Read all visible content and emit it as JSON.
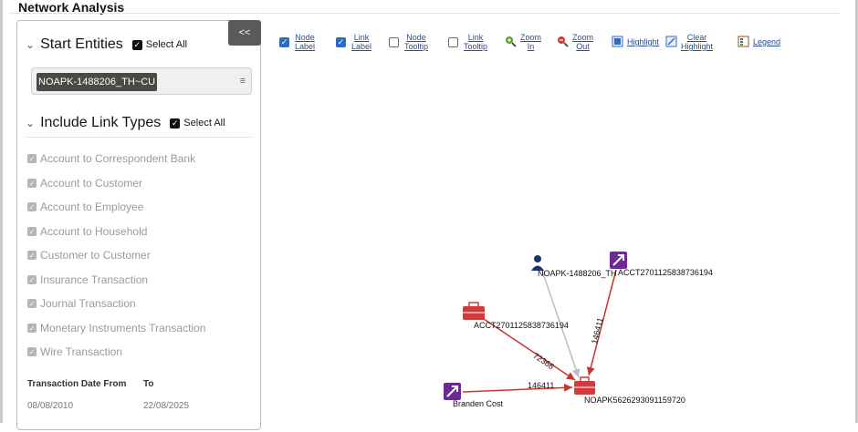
{
  "page": {
    "title": "Network Analysis"
  },
  "panel": {
    "collapse_label": "<<",
    "start_entities": {
      "title": "Start Entities",
      "select_all": "Select All",
      "entity_chip": "NOAPK-1488206_TH~CU"
    },
    "link_types": {
      "title": "Include Link Types",
      "select_all": "Select All",
      "items": [
        "Account to Correspondent Bank",
        "Account to Customer",
        "Account to Employee",
        "Account to Household",
        "Customer to Customer",
        "Insurance Transaction",
        "Journal Transaction",
        "Monetary Instruments Transaction",
        "Wire Transaction"
      ]
    },
    "dates": {
      "from_label": "Transaction Date From",
      "to_label": "To",
      "from_value": "08/08/2010",
      "to_value": "22/08/2025"
    }
  },
  "toolbar": {
    "node_label": [
      "Node",
      "Label"
    ],
    "link_label": [
      "Link",
      "Label"
    ],
    "node_tooltip": [
      "Node",
      "Tooltip"
    ],
    "link_tooltip": [
      "Link",
      "Tooltip"
    ],
    "zoom_in": [
      "Zoom",
      "In"
    ],
    "zoom_out": [
      "Zoom",
      "Out"
    ],
    "highlight": "Highlight",
    "clear_highlight": [
      "Clear",
      "Highlight"
    ],
    "legend": "Legend",
    "node_label_checked": true,
    "link_label_checked": true,
    "node_tooltip_checked": false,
    "link_tooltip_checked": false
  },
  "graph": {
    "nodes": [
      {
        "id": "customer",
        "label": "NOAPK-1488206_TH",
        "type": "customer",
        "color": "#13396b"
      },
      {
        "id": "acct_top",
        "label": "ACCT2701125838736194",
        "type": "external-account",
        "color": "#6a2c91"
      },
      {
        "id": "acct_left",
        "label": "ACCT2701125838736194",
        "type": "account",
        "color": "#d33a3a"
      },
      {
        "id": "branden",
        "label": "Branden Cost",
        "type": "external-account",
        "color": "#6a2c91"
      },
      {
        "id": "target",
        "label": "NOAPK5626293091159720",
        "type": "account",
        "color": "#d33a3a"
      }
    ],
    "edges": [
      {
        "from": "customer",
        "to": "target",
        "label": "",
        "color": "#bdbdbd"
      },
      {
        "from": "acct_top",
        "to": "target",
        "label": "146411",
        "color": "#c8372d"
      },
      {
        "from": "acct_left",
        "to": "target",
        "label": "72366",
        "color": "#c8372d"
      },
      {
        "from": "branden",
        "to": "target",
        "label": "146411",
        "color": "#c8372d"
      }
    ]
  }
}
